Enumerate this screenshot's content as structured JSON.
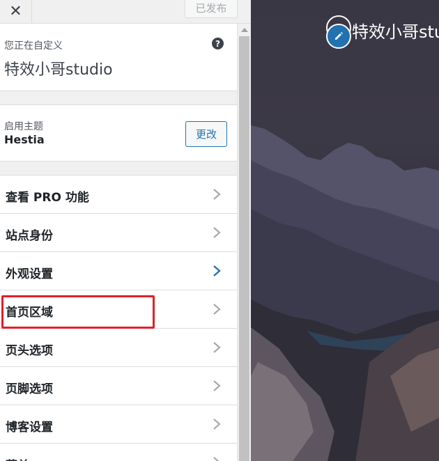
{
  "topbar": {
    "close_icon": "close-icon",
    "publish_label": "已发布"
  },
  "info": {
    "customizing_label": "您正在自定义",
    "site_title": "特效小哥studio",
    "help_glyph": "?"
  },
  "theme": {
    "label": "启用主题",
    "name": "Hestia",
    "change_label": "更改"
  },
  "menu": {
    "items": [
      {
        "label": "查看 PRO 功能",
        "chevron_color": "#a7aaad"
      },
      {
        "label": "站点身份",
        "chevron_color": "#a7aaad"
      },
      {
        "label": "外观设置",
        "chevron_color": "#2271b1"
      },
      {
        "label": "首页区域",
        "chevron_color": "#a7aaad"
      },
      {
        "label": "页头选项",
        "chevron_color": "#a7aaad"
      },
      {
        "label": "页脚选项",
        "chevron_color": "#a7aaad"
      },
      {
        "label": "博客设置",
        "chevron_color": "#a7aaad"
      },
      {
        "label": "菜单",
        "chevron_color": "#a7aaad"
      }
    ]
  },
  "preview": {
    "site_title": "特效小哥studio"
  },
  "colors": {
    "accent": "#2271b1",
    "highlight": "#e0202a"
  }
}
